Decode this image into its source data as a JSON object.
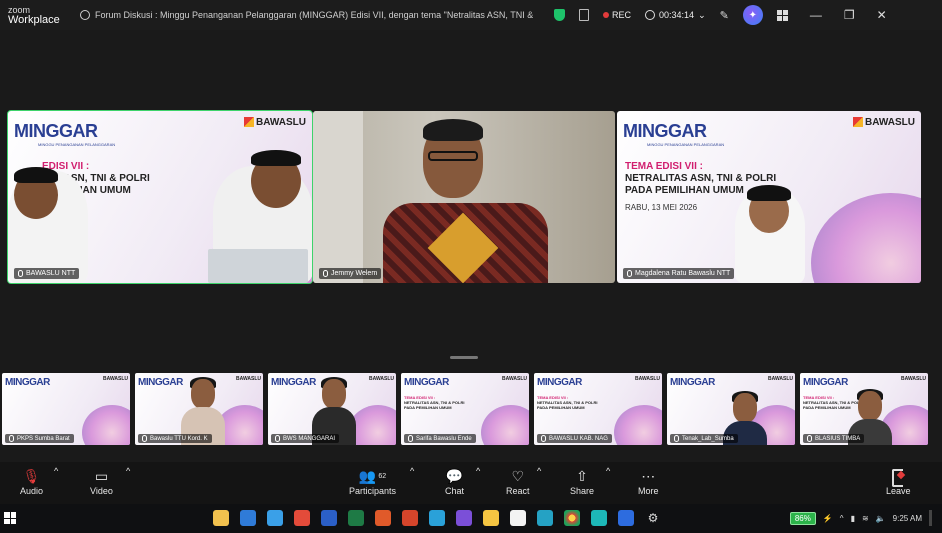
{
  "app": {
    "logo_line1": "zoom",
    "logo_line2": "Workplace",
    "meeting_title": "Forum Diskusi : Minggu Penanganan Pelanggaran (MINGGAR) Edisi VII, dengan tema \"Netralitas ASN, TNI &",
    "rec_label": "REC",
    "timer": "00:34:14"
  },
  "slide": {
    "brand": "MINGGAR",
    "brand_sub": "MINGGU PENANGANAN PELANGGARAN",
    "org": "BAWASLU",
    "theme_label": "TEMA EDISI VII :",
    "theme_line1": "NETRALITAS ASN, TNI & POLRI",
    "theme_line2": "PADA PEMILIHAN UMUM",
    "date": "RABU, 13 MEI 2026",
    "tile1_l1": "EDISI VII :",
    "tile1_l2": "TAS ASN, TNI & POLRI",
    "tile1_l3": "PEMILIHAN UMUM",
    "tile1_date": "MEI 2026"
  },
  "main_tiles": [
    {
      "name": "BAWASLU NTT"
    },
    {
      "name": "Jemmy Welem"
    },
    {
      "name": "Magdalena Ratu Bawaslu NTT"
    }
  ],
  "strip": [
    {
      "name": "PKPS Sumba Barat"
    },
    {
      "name": "Bawaslu TTU Kord. K"
    },
    {
      "name": "BWS MANGGARAI"
    },
    {
      "name": "Sarifa Bawaslu Ende"
    },
    {
      "name": "BAWASLU KAB. NAG"
    },
    {
      "name": "Tenak_Lab_Sumba"
    },
    {
      "name": "BLASIUS TIMBA"
    }
  ],
  "toolbar": {
    "audio": "Audio",
    "video": "Video",
    "participants": "Participants",
    "participants_count": "62",
    "chat": "Chat",
    "react": "React",
    "share": "Share",
    "more": "More",
    "leave": "Leave"
  },
  "taskbar": {
    "battery": "86%",
    "time": "9:25 AM"
  },
  "colors": {
    "active_speaker": "#3ed36b",
    "rec": "#e23b3b",
    "minggar_blue": "#2a3f93",
    "theme_pink": "#d11f6f"
  }
}
